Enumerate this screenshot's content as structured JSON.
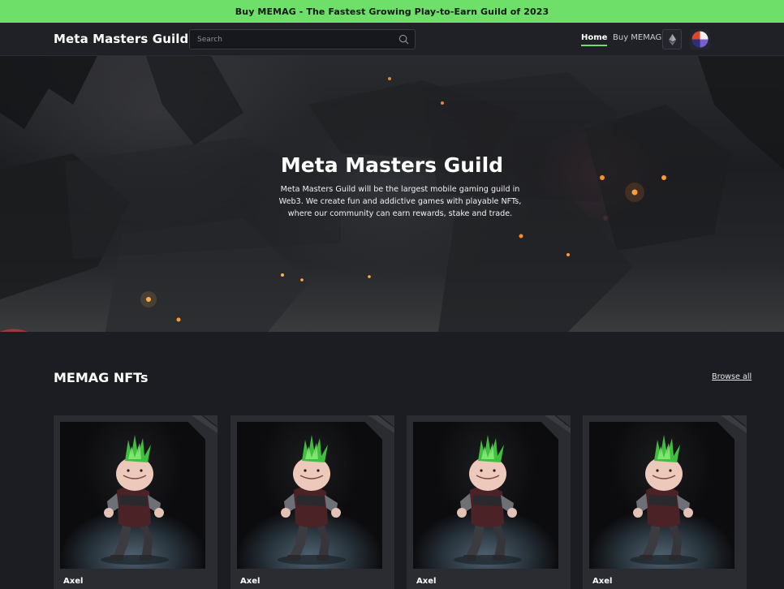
{
  "promo": {
    "text": "Buy MEMAG - The Fastest Growing Play-to-Earn Guild of 2023"
  },
  "header": {
    "brand": "Meta Masters Guild",
    "search_placeholder": "Search",
    "nav": {
      "home": "Home",
      "buy": "Buy MEMAG"
    },
    "icons": {
      "search": "search-icon",
      "network": "ethereum-icon",
      "avatar": "wallet-avatar"
    }
  },
  "hero": {
    "title": "Meta Masters Guild",
    "description": "Meta Masters Guild will be the largest mobile gaming guild in Web3. We create fun and addictive games with playable NFTs, where our community can earn rewards, stake and trade."
  },
  "nft_section": {
    "title": "MEMAG NFTs",
    "browse_label": "Browse all",
    "cards": [
      {
        "name": "Axel"
      },
      {
        "name": "Axel"
      },
      {
        "name": "Axel"
      },
      {
        "name": "Axel"
      }
    ]
  },
  "colors": {
    "accent": "#6ee06a",
    "background": "#1b1d22",
    "header": "#1f2126",
    "card": "#2a2c31"
  }
}
